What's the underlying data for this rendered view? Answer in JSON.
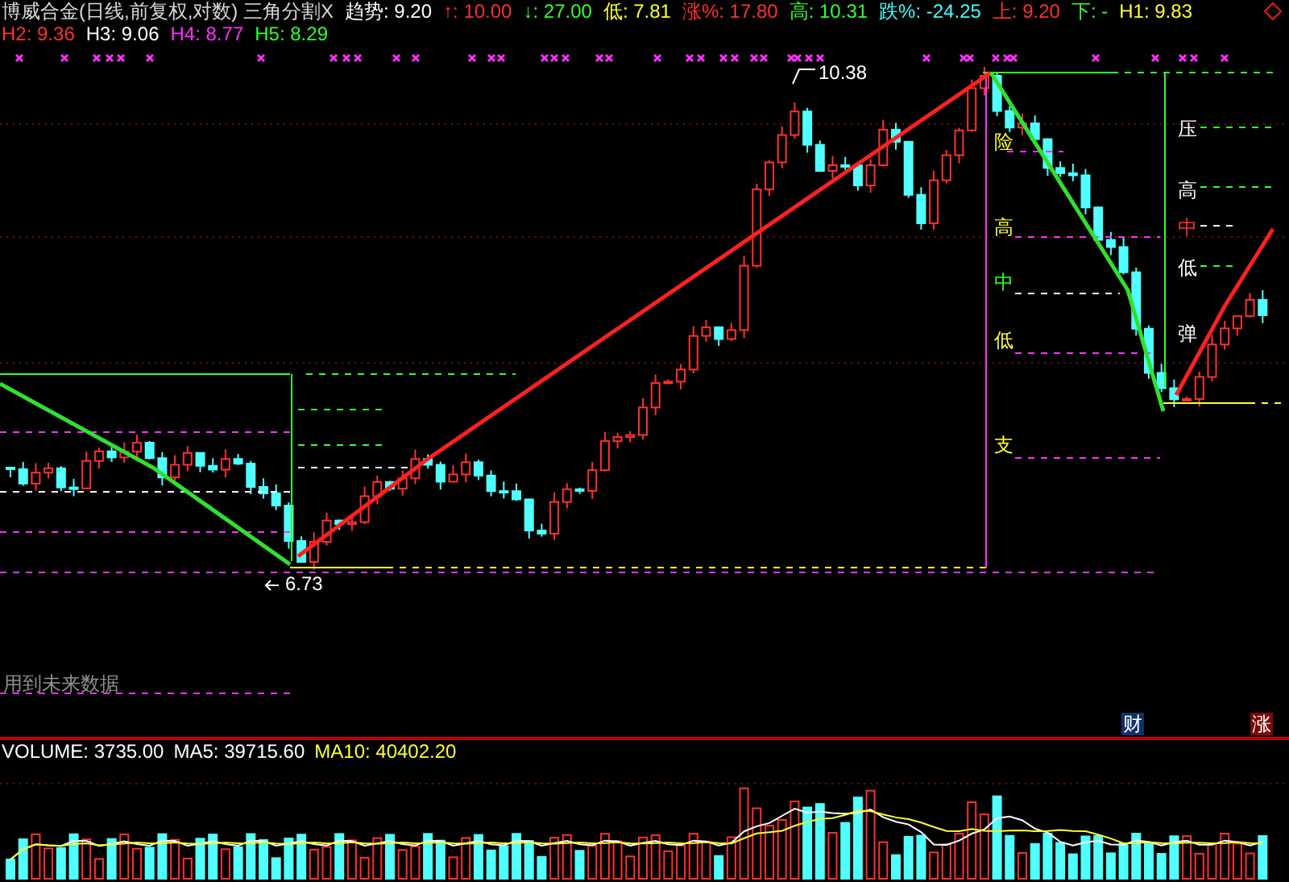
{
  "header": {
    "title": "博威合金(日线,前复权,对数) 三角分割X",
    "line_1": [
      {
        "text": "趋势: 9.20",
        "color": "#ffffff"
      },
      {
        "text": "↑: 10.00",
        "color": "#ff3030"
      },
      {
        "text": "↓: 27.00",
        "color": "#30ff30"
      },
      {
        "text": "低: 7.81",
        "color": "#ffff30"
      },
      {
        "text": "涨%: 17.80",
        "color": "#ff3030"
      },
      {
        "text": "高: 10.31",
        "color": "#30ff30"
      },
      {
        "text": "跌%: -24.25",
        "color": "#40ffff"
      },
      {
        "text": "上: 9.20",
        "color": "#ff3030"
      },
      {
        "text": "下: -",
        "color": "#30ff30"
      },
      {
        "text": "H1: 9.83",
        "color": "#ffff30"
      }
    ],
    "line_2": [
      {
        "text": "H2: 9.36",
        "color": "#ff3030"
      },
      {
        "text": "H3: 9.06",
        "color": "#ffffff"
      },
      {
        "text": "H4: 8.77",
        "color": "#ff30ff"
      },
      {
        "text": "H5: 8.29",
        "color": "#30ff30"
      }
    ]
  },
  "price_chart": {
    "high_label": "10.38",
    "low_label": "6.73",
    "mid_labels": [
      {
        "text": "险",
        "color": "#ffff30"
      },
      {
        "text": "高",
        "color": "#ffff30"
      },
      {
        "text": "中",
        "color": "#30ff30"
      },
      {
        "text": "低",
        "color": "#ffff30"
      },
      {
        "text": "支",
        "color": "#ffff30"
      }
    ],
    "right_labels": [
      {
        "text": "压",
        "color": "#ffffff"
      },
      {
        "text": "高",
        "color": "#ffffff"
      },
      {
        "text": "中",
        "color": "#ff3030"
      },
      {
        "text": "低",
        "color": "#ffffff"
      },
      {
        "text": "弹",
        "color": "#ffffff"
      }
    ],
    "note": "用到未来数据",
    "badges": [
      {
        "text": "财",
        "color": "#10306a"
      },
      {
        "text": "涨",
        "color": "#7a0a0a"
      }
    ]
  },
  "volume": {
    "items": [
      {
        "text": "VOLUME: 3735.00",
        "color": "#ffffff"
      },
      {
        "text": "MA5: 39715.60",
        "color": "#ffffff"
      },
      {
        "text": "MA10: 40402.20",
        "color": "#ffff30"
      }
    ]
  }
}
